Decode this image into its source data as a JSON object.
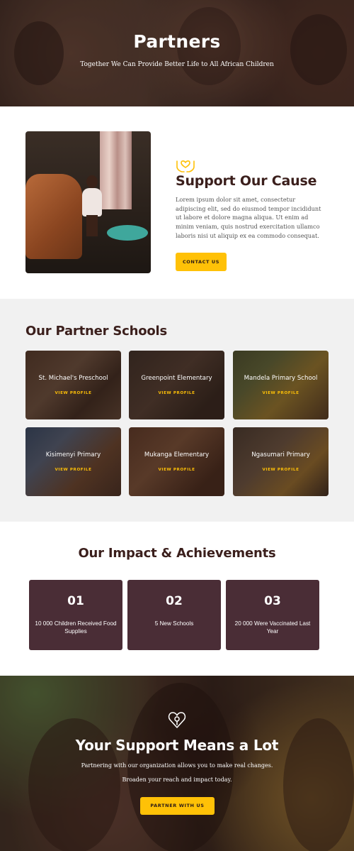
{
  "hero": {
    "title": "Partners",
    "subtitle": "Together We Can Provide Better Life to All African Children"
  },
  "support": {
    "icon": "hands-heart-icon",
    "title": "Support Our Cause",
    "text": "Lorem ipsum dolor sit amet, consectetur adipiscing elit, sed do eiusmod tempor incididunt ut labore et dolore magna aliqua. Ut enim ad minim veniam, quis nostrud exercitation ullamco laboris nisi ut aliquip ex ea commodo consequat.",
    "button": "CONTACT US"
  },
  "schools": {
    "title": "Our Partner Schools",
    "view_label": "VIEW PROFILE",
    "items": [
      {
        "name": "St. Michael's Preschool"
      },
      {
        "name": "Greenpoint Elementary"
      },
      {
        "name": "Mandela Primary School"
      },
      {
        "name": "Kisimenyi Primary"
      },
      {
        "name": "Mukanga Elementary"
      },
      {
        "name": "Ngasumari Primary"
      }
    ]
  },
  "impact": {
    "title": "Our Impact & Achievements",
    "stats": [
      {
        "num": "01",
        "label": "10 000 Children Received Food Supplies"
      },
      {
        "num": "02",
        "label": "5 New Schools"
      },
      {
        "num": "03",
        "label": "20 000 Were Vaccinated Last Year"
      }
    ]
  },
  "banner": {
    "icon": "heart-pin-icon",
    "title": "Your Support Means a Lot",
    "line1": "Partnering with our organization allows you to make real changes.",
    "line2": "Broaden your reach and impact today.",
    "button": "PARTNER WITH US"
  },
  "colors": {
    "accent": "#ffc107",
    "heading": "#3b1f1c",
    "stat_bg": "#4a2d36"
  }
}
